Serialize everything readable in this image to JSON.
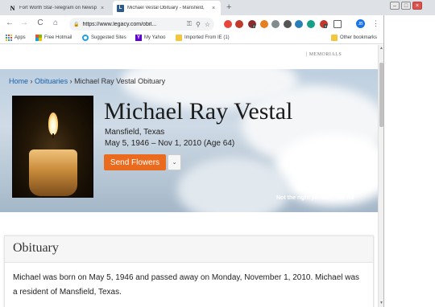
{
  "browser": {
    "tabs": [
      {
        "title": "Fort Worth Star-Telegram on Newsp",
        "close": "×",
        "icon": "newspapers-n-icon",
        "favicon": "N"
      },
      {
        "title": "Michael Vestal Obituary - Mansfield,",
        "close": "×",
        "icon": "legacy-l-icon",
        "favicon": "L"
      }
    ],
    "new_tab": "+",
    "window_controls": {
      "minimize": "–",
      "maximize": "□",
      "close": "×"
    },
    "nav": {
      "back": "←",
      "forward": "→",
      "reload": "C",
      "home": "⌂"
    },
    "address": {
      "lock": "🔒",
      "url": "https://www.legacy.com/obit..."
    },
    "address_icons": {
      "key": "⚿",
      "zoom": "⚲",
      "star": "☆"
    },
    "extensions": [
      {
        "name": "chrome-icon",
        "color": "#e8453c"
      },
      {
        "name": "extension-icon",
        "color": "#c0392b"
      },
      {
        "name": "extension-icon",
        "color": "#8e2b2b",
        "badge": "2"
      },
      {
        "name": "extension-icon",
        "color": "#e67e22"
      },
      {
        "name": "extension-icon",
        "color": "#7f8c8d"
      },
      {
        "name": "extension-icon",
        "color": "#555555"
      },
      {
        "name": "extension-icon",
        "color": "#2980b9"
      },
      {
        "name": "extension-icon",
        "color": "#16a085"
      },
      {
        "name": "extension-icon",
        "color": "#c0392b",
        "badge": "5"
      },
      {
        "name": "cast-icon",
        "color": "#5f6368"
      }
    ],
    "profile_initials": "JB",
    "menu": "⋮",
    "bookmarks": [
      {
        "label": "Apps",
        "icon": "apps-grid-icon"
      },
      {
        "label": "Free Hotmail",
        "icon": "windows-logo-icon"
      },
      {
        "label": "Suggested Sites",
        "icon": "ie-logo-icon"
      },
      {
        "label": "My Yahoo",
        "icon": "yahoo-logo-icon",
        "glyph": "Y"
      },
      {
        "label": "Imported From IE (1)",
        "icon": "folder-icon"
      },
      {
        "label": "Other bookmarks",
        "icon": "folder-icon"
      }
    ]
  },
  "page": {
    "nav_memorials": "| MEMORIALS",
    "breadcrumb": {
      "home": "Home",
      "sep1": "›",
      "obits": "Obituaries",
      "sep2": "›",
      "current": "Michael Ray Vestal Obituary"
    },
    "name": "Michael Ray Vestal",
    "location": "Mansfield, Texas",
    "dates": "May 5, 1946 – Nov 1, 2010 (Age 64)",
    "send_flowers": "Send Flowers",
    "dropdown_glyph": "⌄",
    "not_right": "Not the right person? See All",
    "obituary_heading": "Obituary",
    "obituary_text": "Michael was born on May 5, 1946 and passed away on Monday, November 1, 2010. Michael was a resident of Mansfield, Texas."
  },
  "scrollbar": {
    "up": "▲",
    "down": "▼"
  }
}
